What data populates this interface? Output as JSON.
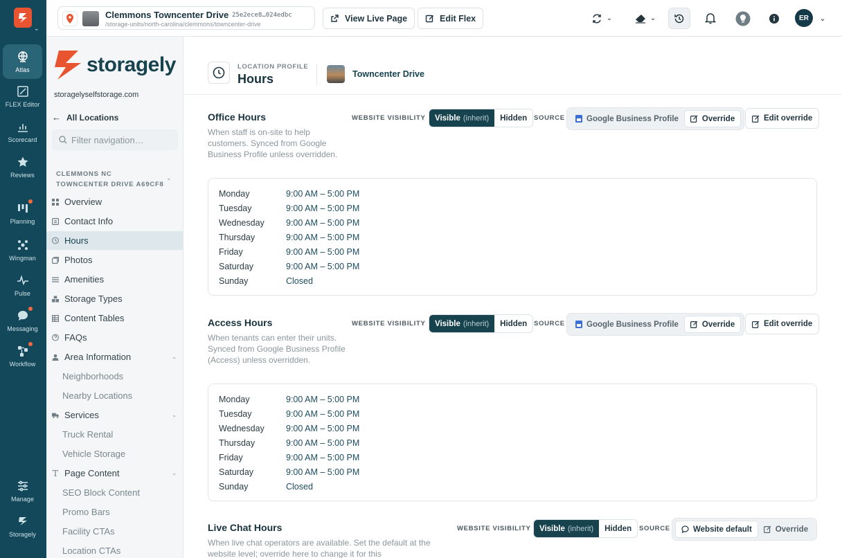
{
  "rail": {
    "items": [
      {
        "label": "Atlas",
        "icon": "globe-icon"
      },
      {
        "label": "FLEX Editor",
        "icon": "edit-canvas-icon"
      },
      {
        "label": "Scorecard",
        "icon": "bar-chart-icon"
      },
      {
        "label": "Reviews",
        "icon": "star-icon"
      },
      {
        "label": "Planning",
        "icon": "kanban-icon"
      },
      {
        "label": "Wingman",
        "icon": "network-icon"
      },
      {
        "label": "Pulse",
        "icon": "pulse-icon"
      },
      {
        "label": "Messaging",
        "icon": "chat-icon"
      },
      {
        "label": "Workflow",
        "icon": "workflow-icon"
      },
      {
        "label": "Manage",
        "icon": "sliders-icon"
      },
      {
        "label": "Storagely",
        "icon": "storagely-icon"
      }
    ]
  },
  "topbar": {
    "location_name": "Clemmons Towncenter Drive",
    "location_id": "25e2ece8…024edbc",
    "location_path": "/storage-units/north-carolina/clemmons/towncenter-drive",
    "view_live": "View Live Page",
    "edit_flex": "Edit Flex",
    "avatar": "ER"
  },
  "nav": {
    "brand": "storagely",
    "domain": "storagelyselfstorage.com",
    "all_locations": "All Locations",
    "filter_placeholder": "Filter navigation…",
    "group_line1": "CLEMMONS NC",
    "group_line2": "TOWNCENTER DRIVE A69CF8",
    "items": [
      {
        "label": "Overview"
      },
      {
        "label": "Contact Info"
      },
      {
        "label": "Hours"
      },
      {
        "label": "Photos"
      },
      {
        "label": "Amenities"
      },
      {
        "label": "Storage Types"
      },
      {
        "label": "Content Tables"
      },
      {
        "label": "FAQs"
      },
      {
        "label": "Area Information"
      },
      {
        "label": "Neighborhoods"
      },
      {
        "label": "Nearby Locations"
      },
      {
        "label": "Services"
      },
      {
        "label": "Truck Rental"
      },
      {
        "label": "Vehicle Storage"
      },
      {
        "label": "Page Content"
      },
      {
        "label": "SEO Block Content"
      },
      {
        "label": "Promo Bars"
      },
      {
        "label": "Facility CTAs"
      },
      {
        "label": "Location CTAs"
      }
    ]
  },
  "page": {
    "kicker": "LOCATION PROFILE",
    "title": "Hours",
    "location": "Towncenter Drive"
  },
  "labels": {
    "website_visibility": "WEBSITE VISIBILITY",
    "visible": "Visible",
    "inherit": "(inherit)",
    "hidden": "Hidden",
    "source": "SOURCE",
    "gbp": "Google Business Profile",
    "override": "Override",
    "edit_override": "Edit override",
    "website_default": "Website default"
  },
  "sections": [
    {
      "title": "Office Hours",
      "description": "When staff is on-site to help customers. Synced from Google Business Profile unless overridden.",
      "hours": [
        {
          "day": "Monday",
          "time": "9:00 AM – 5:00 PM"
        },
        {
          "day": "Tuesday",
          "time": "9:00 AM – 5:00 PM"
        },
        {
          "day": "Wednesday",
          "time": "9:00 AM – 5:00 PM"
        },
        {
          "day": "Thursday",
          "time": "9:00 AM – 5:00 PM"
        },
        {
          "day": "Friday",
          "time": "9:00 AM – 5:00 PM"
        },
        {
          "day": "Saturday",
          "time": "9:00 AM – 5:00 PM"
        },
        {
          "day": "Sunday",
          "time": "Closed"
        }
      ]
    },
    {
      "title": "Access Hours",
      "description": "When tenants can enter their units. Synced from Google Business Profile (Access) unless overridden.",
      "hours": [
        {
          "day": "Monday",
          "time": "9:00 AM – 5:00 PM"
        },
        {
          "day": "Tuesday",
          "time": "9:00 AM – 5:00 PM"
        },
        {
          "day": "Wednesday",
          "time": "9:00 AM – 5:00 PM"
        },
        {
          "day": "Thursday",
          "time": "9:00 AM – 5:00 PM"
        },
        {
          "day": "Friday",
          "time": "9:00 AM – 5:00 PM"
        },
        {
          "day": "Saturday",
          "time": "9:00 AM – 5:00 PM"
        },
        {
          "day": "Sunday",
          "time": "Closed"
        }
      ]
    },
    {
      "title": "Live Chat Hours",
      "description": "When live chat operators are available. Set the default at the website level; override here to change it for this"
    }
  ],
  "colors": {
    "brand_orange": "#e8542f",
    "rail": "#12485a",
    "accent": "#17434f",
    "notify": "#f26a3d",
    "visible_dot": "#22b573"
  }
}
